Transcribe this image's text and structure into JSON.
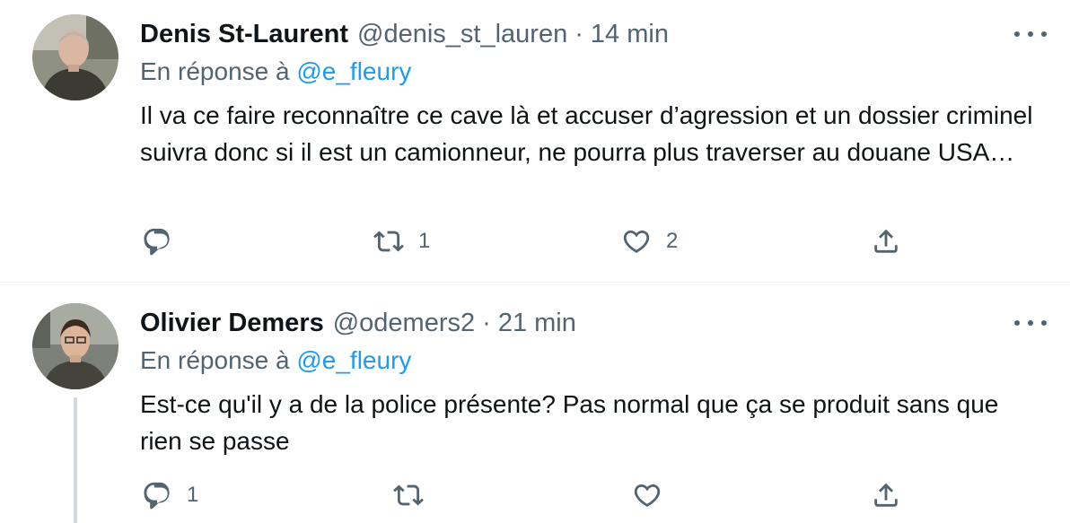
{
  "tweets": [
    {
      "name": "Denis St-Laurent",
      "handle": "@denis_st_lauren",
      "separator": "·",
      "time": "14 min",
      "reply_prefix": "En réponse à",
      "reply_mention": "@e_fleury",
      "text": "Il va ce faire reconnaître ce cave là et accuser d’agression et un dossier criminel suivra donc si il est un camionneur, ne pourra plus traverser au douane USA…",
      "reply_count": "",
      "retweet_count": "1",
      "like_count": "2"
    },
    {
      "name": "Olivier Demers",
      "handle": "@odemers2",
      "separator": "·",
      "time": "21 min",
      "reply_prefix": "En réponse à",
      "reply_mention": "@e_fleury",
      "text": "Est-ce qu'il y a de la police présente? Pas normal que ça se produit sans que rien se passe",
      "reply_count": "1",
      "retweet_count": "",
      "like_count": ""
    }
  ],
  "icons": {
    "reply": "reply-icon",
    "retweet": "retweet-icon",
    "like": "heart-icon",
    "share": "share-icon",
    "more": "more-icon"
  },
  "colors": {
    "text": "#0f1419",
    "secondary": "#536471",
    "link": "#1d9bf0",
    "divider": "#eff3f4",
    "thread_line": "#cfd9de"
  }
}
